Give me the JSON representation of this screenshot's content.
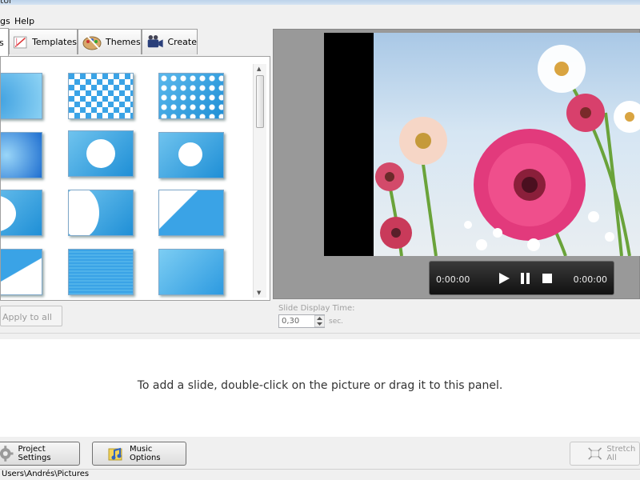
{
  "window": {
    "title_fragment": "tor"
  },
  "menu": {
    "items": [
      "gs",
      "Help"
    ]
  },
  "tabs": [
    {
      "label": "s",
      "icon": "transitions-icon"
    },
    {
      "label": "Templates",
      "icon": "templates-icon"
    },
    {
      "label": "Themes",
      "icon": "palette-icon"
    },
    {
      "label": "Create",
      "icon": "camera-icon"
    }
  ],
  "transitions": {
    "apply_all_label": "Apply to all",
    "selected_index": 4
  },
  "player": {
    "current_time": "0:00:00",
    "total_time": "0:00:00"
  },
  "slide_time": {
    "label": "Slide Display Time:",
    "value": "0,30",
    "unit": "sec."
  },
  "slide_panel": {
    "hint": "To add a slide, double-click on the picture or drag it to this panel."
  },
  "buttons": {
    "project_settings": "Project Settings",
    "music_options": "Music Options",
    "stretch_all": "Stretch All"
  },
  "status": {
    "path": "Users\\Andrés\\Pictures"
  },
  "colors": {
    "selection": "#1e7fd0",
    "thumb_blue": "#1f8fd6",
    "flower_pink": "#e23a7c"
  }
}
